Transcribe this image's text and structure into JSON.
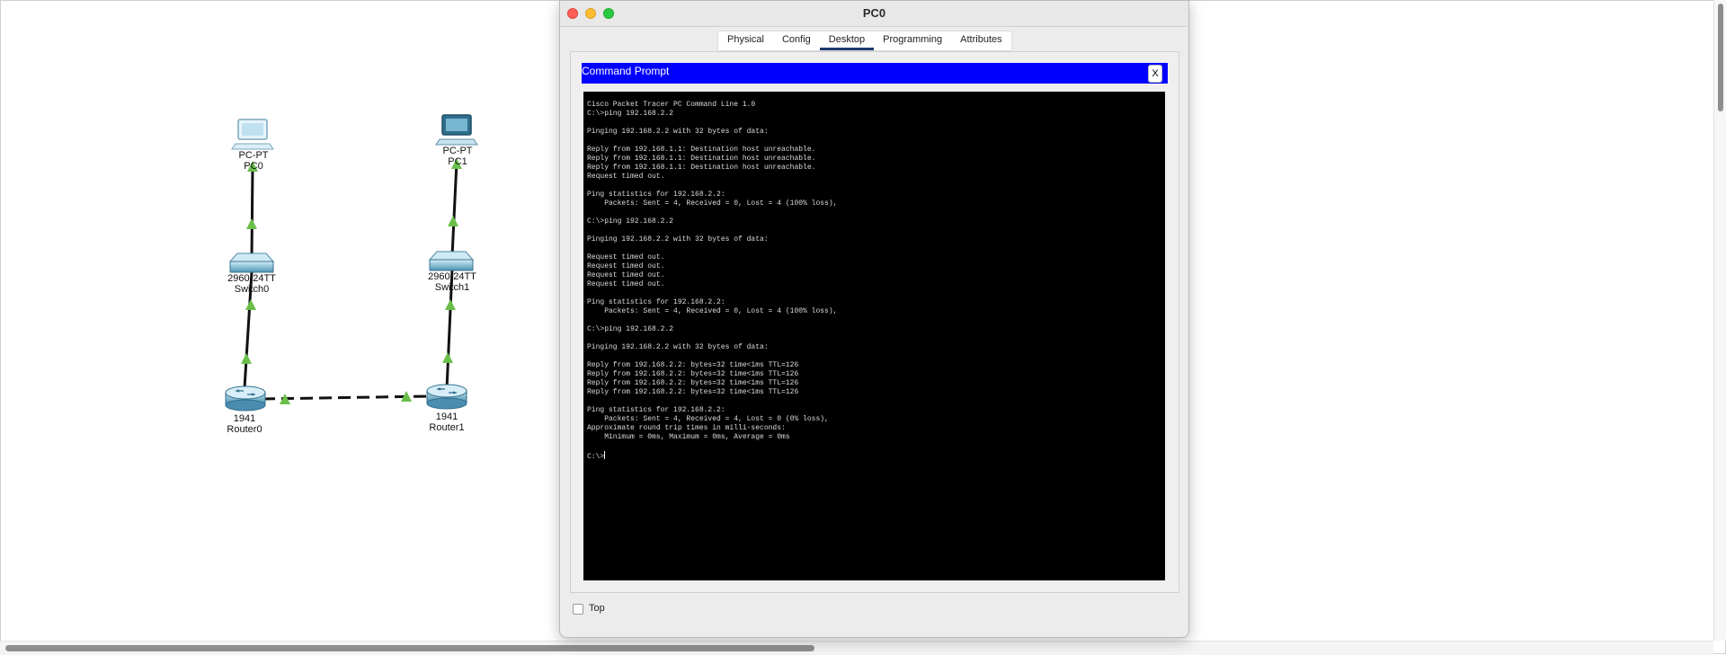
{
  "window": {
    "title": "PC0",
    "tabs": [
      "Physical",
      "Config",
      "Desktop",
      "Programming",
      "Attributes"
    ],
    "active_tab": "Desktop"
  },
  "command_prompt": {
    "title": "Command Prompt",
    "close_label": "X",
    "lines": [
      "Cisco Packet Tracer PC Command Line 1.0",
      "C:\\>ping 192.168.2.2",
      "",
      "Pinging 192.168.2.2 with 32 bytes of data:",
      "",
      "Reply from 192.168.1.1: Destination host unreachable.",
      "Reply from 192.168.1.1: Destination host unreachable.",
      "Reply from 192.168.1.1: Destination host unreachable.",
      "Request timed out.",
      "",
      "Ping statistics for 192.168.2.2:",
      "    Packets: Sent = 4, Received = 0, Lost = 4 (100% loss),",
      "",
      "C:\\>ping 192.168.2.2",
      "",
      "Pinging 192.168.2.2 with 32 bytes of data:",
      "",
      "Request timed out.",
      "Request timed out.",
      "Request timed out.",
      "Request timed out.",
      "",
      "Ping statistics for 192.168.2.2:",
      "    Packets: Sent = 4, Received = 0, Lost = 4 (100% loss),",
      "",
      "C:\\>ping 192.168.2.2",
      "",
      "Pinging 192.168.2.2 with 32 bytes of data:",
      "",
      "Reply from 192.168.2.2: bytes=32 time<1ms TTL=126",
      "Reply from 192.168.2.2: bytes=32 time<1ms TTL=126",
      "Reply from 192.168.2.2: bytes=32 time<1ms TTL=126",
      "Reply from 192.168.2.2: bytes=32 time<1ms TTL=126",
      "",
      "Ping statistics for 192.168.2.2:",
      "    Packets: Sent = 4, Received = 4, Lost = 0 (0% loss),",
      "Approximate round trip times in milli-seconds:",
      "    Minimum = 0ms, Maximum = 0ms, Average = 0ms",
      "",
      "C:\\>"
    ]
  },
  "top_checkbox": {
    "label": "Top",
    "checked": false
  },
  "topology": {
    "pc0": {
      "model": "PC-PT",
      "name": "PC0",
      "icon": "pc-icon"
    },
    "pc1": {
      "model": "PC-PT",
      "name": "PC1",
      "icon": "pc-icon"
    },
    "switch0": {
      "model": "2960-24TT",
      "name": "Switch0",
      "icon": "switch-icon"
    },
    "switch1": {
      "model": "2960-24TT",
      "name": "Switch1",
      "icon": "switch-icon"
    },
    "router0": {
      "model": "1941",
      "name": "Router0",
      "icon": "router-icon"
    },
    "router1": {
      "model": "1941",
      "name": "Router1",
      "icon": "router-icon"
    },
    "link_status_color": "#6abf4b"
  }
}
